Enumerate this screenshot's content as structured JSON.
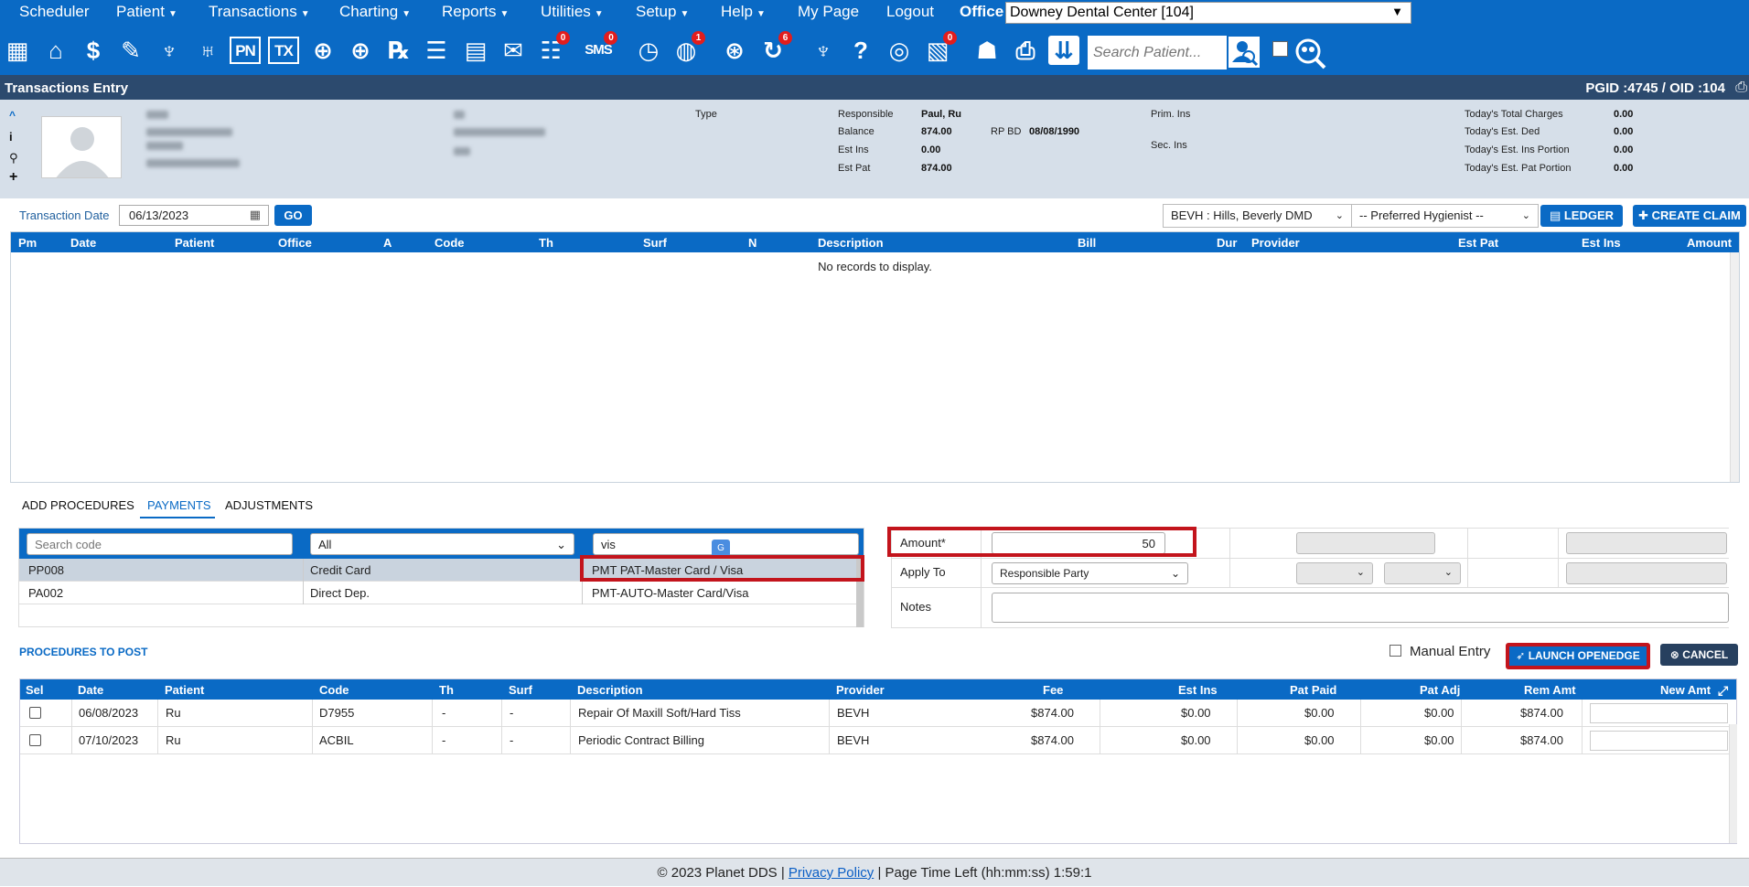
{
  "menu": {
    "items": [
      {
        "label": "Scheduler",
        "caret": false
      },
      {
        "label": "Patient",
        "caret": true
      },
      {
        "label": "Transactions",
        "caret": true
      },
      {
        "label": "Charting",
        "caret": true
      },
      {
        "label": "Reports",
        "caret": true
      },
      {
        "label": "Utilities",
        "caret": true
      },
      {
        "label": "Setup",
        "caret": true
      },
      {
        "label": "Help",
        "caret": true
      },
      {
        "label": "My Page",
        "caret": false
      },
      {
        "label": "Logout",
        "caret": false
      }
    ],
    "office_label": "Office",
    "office_value": "Downey Dental Center [104]"
  },
  "toolbar": {
    "badges": {
      "messages": "0",
      "sms": "0",
      "globe": "1",
      "recall": "6",
      "forms": "0"
    },
    "search_placeholder": "Search Patient...",
    "labels": {
      "pn": "PN",
      "tx": "TX",
      "sms": "SMS"
    }
  },
  "titlebar": {
    "title": "Transactions Entry",
    "ids": "PGID :4745  /  OID :104"
  },
  "patient": {
    "type_label": "Type",
    "responsible_label": "Responsible",
    "responsible_value": "Paul, Ru",
    "balance_label": "Balance",
    "balance_value": "874.00",
    "rp_bd_label": "RP BD",
    "rp_bd_value": "08/08/1990",
    "est_ins_label": "Est Ins",
    "est_ins_value": "0.00",
    "est_pat_label": "Est Pat",
    "est_pat_value": "874.00",
    "prim_ins_label": "Prim. Ins",
    "sec_ins_label": "Sec. Ins",
    "totals": [
      {
        "label": "Today's Total Charges",
        "value": "0.00"
      },
      {
        "label": "Today's Est. Ded",
        "value": "0.00"
      },
      {
        "label": "Today's Est. Ins Portion",
        "value": "0.00"
      },
      {
        "label": "Today's Est. Pat Portion",
        "value": "0.00"
      }
    ]
  },
  "transaction": {
    "date_label": "Transaction Date",
    "date_value": "06/13/2023",
    "go_label": "GO",
    "provider_value": "BEVH : Hills, Beverly DMD",
    "hygienist_value": "-- Preferred Hygienist --",
    "ledger_label": "LEDGER",
    "create_claim_label": "CREATE CLAIM"
  },
  "grid": {
    "columns": [
      "Pm",
      "Date",
      "Patient",
      "Office",
      "A",
      "Code",
      "Th",
      "Surf",
      "N",
      "Description",
      "Bill",
      "Dur",
      "Provider",
      "Est Pat",
      "Est Ins",
      "Amount"
    ],
    "empty_text": "No records to display."
  },
  "tabs": {
    "add": "ADD PROCEDURES",
    "payments": "PAYMENTS",
    "adjustments": "ADJUSTMENTS"
  },
  "payment_codes": {
    "search_placeholder": "Search code",
    "filter_value": "All",
    "desc_search_value": "vis",
    "rows": [
      {
        "code": "PP008",
        "type": "Credit Card",
        "desc": "PMT PAT-Master Card / Visa"
      },
      {
        "code": "PA002",
        "type": "Direct Dep.",
        "desc": "PMT-AUTO-Master Card/Visa"
      }
    ]
  },
  "amount_panel": {
    "amount_label": "Amount*",
    "amount_value": "50",
    "apply_label": "Apply To",
    "apply_value": "Responsible Party",
    "notes_label": "Notes"
  },
  "procedures": {
    "title": "PROCEDURES TO POST",
    "manual_entry_label": "Manual Entry",
    "launch_label": "LAUNCH OPENEDGE",
    "cancel_label": "CANCEL",
    "columns": [
      "Sel",
      "Date",
      "Patient",
      "Code",
      "Th",
      "Surf",
      "Description",
      "Provider",
      "Fee",
      "Est Ins",
      "Pat Paid",
      "Pat Adj",
      "Rem Amt",
      "New Amt"
    ],
    "rows": [
      {
        "date": "06/08/2023",
        "patient": "Ru",
        "code": "D7955",
        "th": "-",
        "surf": "-",
        "desc": "Repair Of Maxill Soft/Hard Tiss",
        "provider": "BEVH",
        "fee": "$874.00",
        "est_ins": "$0.00",
        "pat_paid": "$0.00",
        "pat_adj": "$0.00",
        "rem": "$874.00"
      },
      {
        "date": "07/10/2023",
        "patient": "Ru",
        "code": "ACBIL",
        "th": "-",
        "surf": "-",
        "desc": "Periodic Contract Billing",
        "provider": "BEVH",
        "fee": "$874.00",
        "est_ins": "$0.00",
        "pat_paid": "$0.00",
        "pat_adj": "$0.00",
        "rem": "$874.00"
      }
    ]
  },
  "footer": {
    "copyright": "© 2023 Planet DDS |",
    "privacy": "Privacy Policy",
    "time_left": "|  Page Time Left (hh:mm:ss) 1:59:1"
  },
  "colors": {
    "primary": "#0a6ac5",
    "header_bg": "#d6dfe9",
    "titlebar": "#2c4a6e",
    "highlight": "#c3141c",
    "badge": "#e21d1d"
  }
}
